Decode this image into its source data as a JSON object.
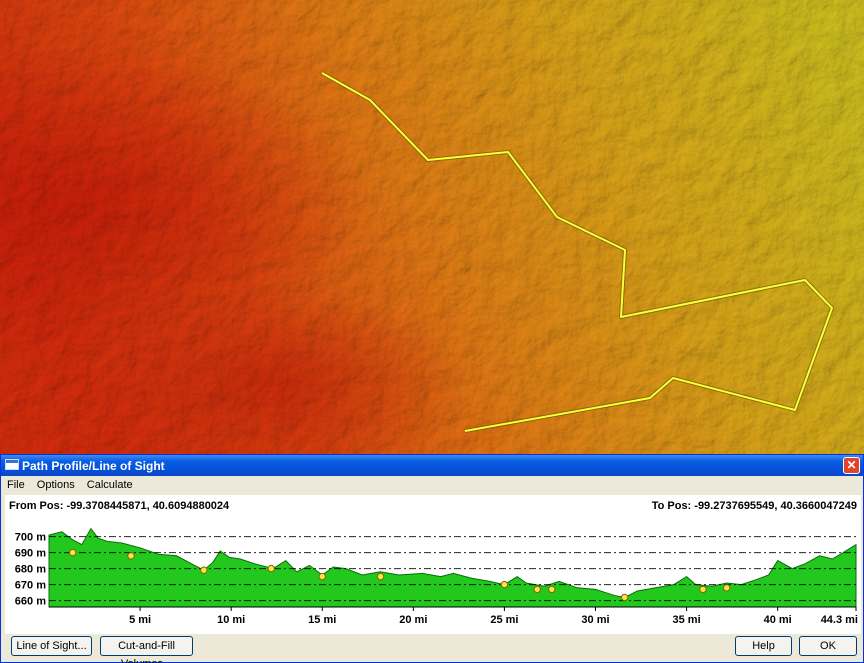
{
  "dialog": {
    "title": "Path Profile/Line of Sight",
    "close_glyph": "✕",
    "menus": [
      "File",
      "Options",
      "Calculate"
    ],
    "from_pos": "From Pos: -99.3708445871, 40.6094880024",
    "to_pos": "To Pos: -99.2737695549, 40.3660047249",
    "buttons": {
      "line_of_sight": "Line of Sight...",
      "cut_and_fill": "Cut-and-Fill Volumes...",
      "help": "Help",
      "ok": "OK"
    }
  },
  "colors": {
    "profile_fill": "#22c81e",
    "profile_outline": "#0b6d08",
    "marker_fill": "#ffe14a",
    "path_line": "#ffff33",
    "titlebar": "#0a5ee0"
  },
  "icons": {
    "window": "window-icon",
    "close": "close-icon"
  },
  "chart_data": {
    "type": "area",
    "y_ticks": [
      "700 m",
      "690 m",
      "680 m",
      "670 m",
      "660 m"
    ],
    "x_ticks": [
      "5 mi",
      "10 mi",
      "15 mi",
      "20 mi",
      "25 mi",
      "30 mi",
      "35 mi",
      "40 mi",
      "44.3 mi"
    ],
    "y_tick_values": [
      700,
      690,
      680,
      670,
      660
    ],
    "x_tick_values": [
      5,
      10,
      15,
      20,
      25,
      30,
      35,
      40,
      44.3
    ],
    "xlim": [
      0,
      44.3
    ],
    "ylim": [
      656,
      706
    ],
    "grid": "dashed horizontal lines",
    "series": [
      {
        "x": [
          0,
          0.7,
          1.3,
          1.8,
          2.3,
          2.7,
          3.2,
          4.0,
          5.0,
          6.0,
          7.0,
          8.0,
          8.5,
          9.0,
          9.4,
          9.9,
          10.5,
          11.3,
          12.3,
          13.0,
          13.6,
          14.3,
          15.0,
          15.6,
          16.3,
          17.2,
          18.2,
          19.2,
          20.5,
          21.5,
          22.2,
          23.2,
          24.2,
          25.0,
          25.7,
          26.2,
          27.2,
          28.0,
          29.0,
          30.0,
          31.1,
          31.6,
          32.3,
          33.3,
          34.3,
          35.0,
          35.5,
          36.4,
          37.2,
          38.0,
          38.8,
          39.5,
          40.0,
          40.8,
          41.5,
          42.3,
          43.0,
          43.6,
          44.3
        ],
        "y": [
          701,
          703,
          698,
          695,
          705,
          699,
          697,
          696,
          693,
          689,
          688,
          682,
          679,
          684,
          691,
          687,
          686,
          683,
          680,
          685,
          678,
          682,
          676,
          681,
          680,
          676,
          678,
          676,
          677,
          675,
          677,
          674,
          672,
          670,
          675,
          671,
          669,
          672,
          668,
          667,
          663,
          662,
          666,
          668,
          670,
          675,
          670,
          669,
          671,
          670,
          673,
          676,
          685,
          680,
          683,
          688,
          686,
          690,
          695
        ]
      }
    ],
    "markers": [
      {
        "x": 1.3,
        "y": 690
      },
      {
        "x": 4.5,
        "y": 688
      },
      {
        "x": 8.5,
        "y": 679
      },
      {
        "x": 12.2,
        "y": 680
      },
      {
        "x": 15.0,
        "y": 675
      },
      {
        "x": 18.2,
        "y": 675
      },
      {
        "x": 25.0,
        "y": 670
      },
      {
        "x": 26.8,
        "y": 667
      },
      {
        "x": 27.6,
        "y": 667
      },
      {
        "x": 31.6,
        "y": 662
      },
      {
        "x": 35.9,
        "y": 667
      },
      {
        "x": 37.2,
        "y": 668
      }
    ]
  }
}
